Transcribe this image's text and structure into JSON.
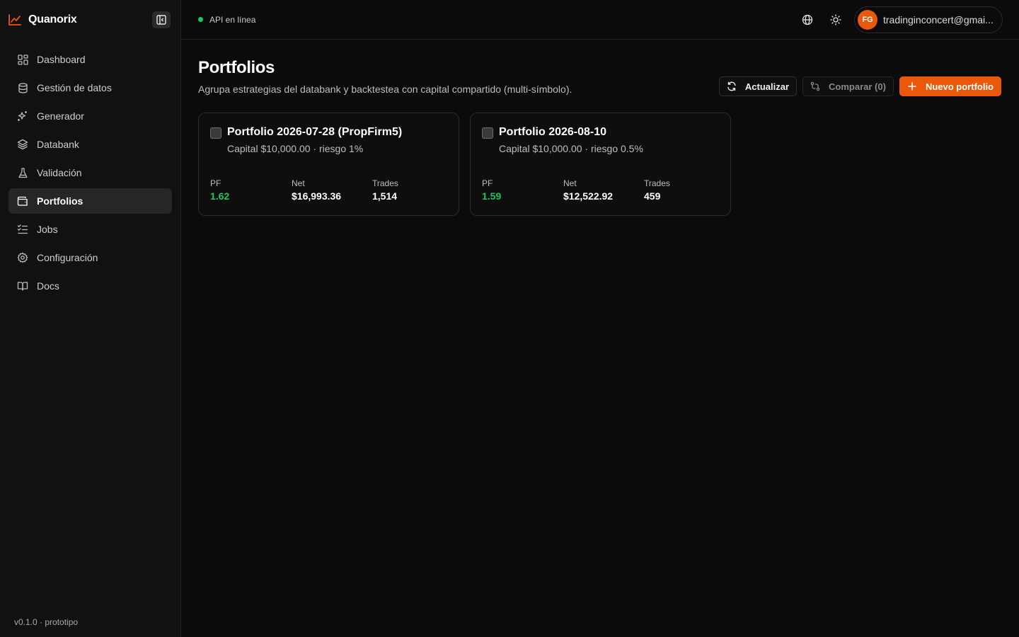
{
  "brand": {
    "name": "Quanorix",
    "accent": "#ea580c"
  },
  "sidebar": {
    "items": [
      {
        "label": "Dashboard",
        "icon": "grid-icon",
        "active": false
      },
      {
        "label": "Gestión de datos",
        "icon": "database-icon",
        "active": false
      },
      {
        "label": "Generador",
        "icon": "sparkles-icon",
        "active": false
      },
      {
        "label": "Databank",
        "icon": "layers-icon",
        "active": false
      },
      {
        "label": "Validación",
        "icon": "flask-icon",
        "active": false
      },
      {
        "label": "Portfolios",
        "icon": "wallet-icon",
        "active": true
      },
      {
        "label": "Jobs",
        "icon": "list-checks-icon",
        "active": false
      },
      {
        "label": "Configuración",
        "icon": "gear-icon",
        "active": false
      },
      {
        "label": "Docs",
        "icon": "book-icon",
        "active": false
      }
    ],
    "version": "v0.1.0 · prototipo"
  },
  "topbar": {
    "status": "API en línea",
    "status_color": "#22c55e",
    "user": {
      "initials": "FG",
      "email": "tradinginconcert@gmai..."
    }
  },
  "page": {
    "title": "Portfolios",
    "subtitle": "Agrupa estrategias del databank y backtestea con capital compartido (multi-símbolo).",
    "actions": {
      "refresh": "Actualizar",
      "compare": "Comparar (0)",
      "new": "Nuevo portfolio"
    }
  },
  "portfolios": [
    {
      "title": "Portfolio 2026-07-28 (PropFirm5)",
      "subtitle": "Capital $10,000.00 · riesgo 1%",
      "stats": [
        {
          "label": "PF",
          "value": "1.62"
        },
        {
          "label": "Net",
          "value": "$16,993.36"
        },
        {
          "label": "Trades",
          "value": "1,514"
        }
      ]
    },
    {
      "title": "Portfolio 2026-08-10",
      "subtitle": "Capital $10,000.00 · riesgo 0.5%",
      "stats": [
        {
          "label": "PF",
          "value": "1.59"
        },
        {
          "label": "Net",
          "value": "$12,522.92"
        },
        {
          "label": "Trades",
          "value": "459"
        }
      ]
    }
  ]
}
